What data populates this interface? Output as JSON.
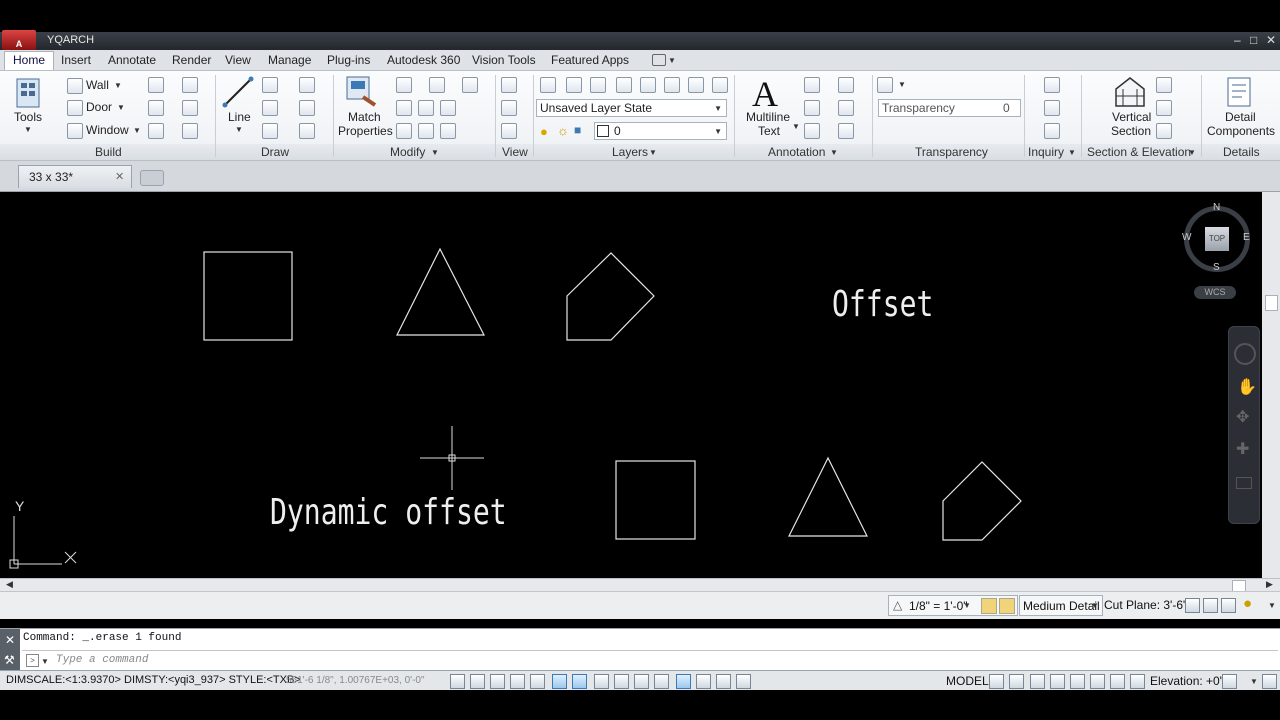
{
  "app": {
    "title": "YQARCH",
    "app_button_label": "A",
    "window_controls": [
      "–",
      "□",
      "✕"
    ]
  },
  "ribbon_tabs": [
    "Home",
    "Insert",
    "Annotate",
    "Render",
    "View",
    "Manage",
    "Plug-ins",
    "Autodesk 360",
    "Vision Tools",
    "Featured Apps"
  ],
  "ribbon": {
    "build": {
      "tools": "Tools",
      "wall": "Wall",
      "door": "Door",
      "window": "Window",
      "label": "Build"
    },
    "draw": {
      "line": "Line",
      "label": "Draw"
    },
    "modify": {
      "match_properties_1": "Match",
      "match_properties_2": "Properties",
      "label": "Modify"
    },
    "view": {
      "label": "View"
    },
    "layers": {
      "layer_state": "Unsaved Layer State",
      "current_layer": "0",
      "label": "Layers"
    },
    "annotation": {
      "mtext_1": "Multiline",
      "mtext_2": "Text",
      "label": "Annotation"
    },
    "transparency": {
      "field_label": "Transparency",
      "value": "0",
      "label": "Transparency"
    },
    "inquiry": {
      "label": "Inquiry"
    },
    "section": {
      "vertical_1": "Vertical",
      "vertical_2": "Section",
      "label": "Section & Elevation"
    },
    "details": {
      "detail_1": "Detail",
      "detail_2": "Components",
      "label": "Details"
    }
  },
  "document_tab": {
    "name": "33 x 33*",
    "close": "✕"
  },
  "canvas": {
    "text_offset": "Offset",
    "text_dynamic_offset": "Dynamic offset",
    "ucs_y": "Y",
    "ucs_x": "X",
    "viewcube": {
      "n": "N",
      "s": "S",
      "e": "E",
      "w": "W",
      "face": "TOP",
      "wcs": "WCS"
    }
  },
  "status_upper": {
    "scale": "1/8\" = 1'-0\"",
    "detail_level": "Medium Detail",
    "cut_plane": "Cut Plane:  3'-6\""
  },
  "command": {
    "history": "Command:  _.erase 1 found",
    "placeholder": "Type a command"
  },
  "status_lower": {
    "dim_info": "DIMSCALE:<1:3.9370> DIMSTY:<yqi3_937> STYLE:<TXB>",
    "coords": "551'-6 1/8\", 1.00767E+03, 0'-0\"",
    "model": "MODEL",
    "elevation": "Elevation: +0\""
  },
  "colors": {
    "canvas": "#000000",
    "ribbon": "#eef1f4",
    "accent": "#3d79b4"
  }
}
